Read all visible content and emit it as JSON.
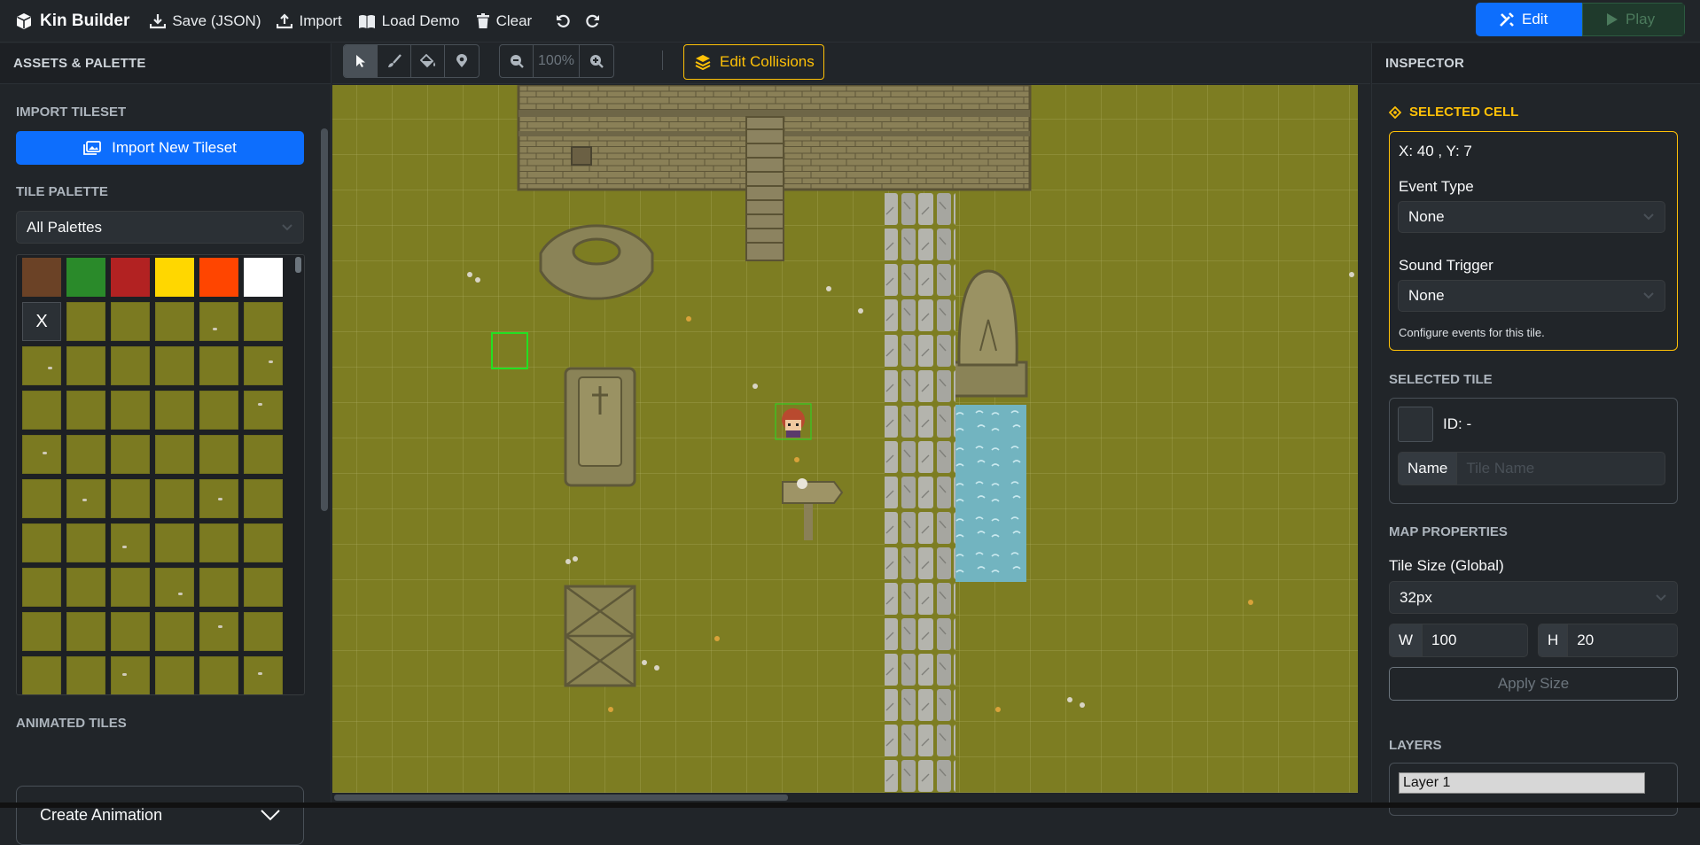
{
  "app": {
    "title": "Kin Builder"
  },
  "toolbar": {
    "save": "Save (JSON)",
    "import": "Import",
    "load_demo": "Load Demo",
    "clear": "Clear",
    "edit": "Edit",
    "play": "Play"
  },
  "left": {
    "header": "ASSETS & PALETTE",
    "import_section": "IMPORT TILESET",
    "import_button": "Import New Tileset",
    "palette_section": "TILE PALETTE",
    "palette_select": "All Palettes",
    "swatches": [
      "#6b4226",
      "#2a8a2a",
      "#b22222",
      "#ffd700",
      "#ff4500",
      "#ffffff"
    ],
    "erase_label": "X",
    "animated_section": "ANIMATED TILES",
    "create_animation": "Create Animation"
  },
  "canvas_tools": {
    "zoom": "100%",
    "edit_collisions": "Edit Collisions"
  },
  "inspector": {
    "header": "INSPECTOR",
    "selected_cell": {
      "title": "SELECTED CELL",
      "coords": "X: 40 , Y: 7",
      "event_type_label": "Event Type",
      "event_type_value": "None",
      "sound_label": "Sound Trigger",
      "sound_value": "None",
      "help": "Configure events for this tile."
    },
    "selected_tile": {
      "title": "SELECTED TILE",
      "id": "ID: -",
      "name_label": "Name",
      "name_placeholder": "Tile Name"
    },
    "map_properties": {
      "title": "MAP PROPERTIES",
      "tile_size_label": "Tile Size (Global)",
      "tile_size_value": "32px",
      "w_label": "W",
      "w_value": "100",
      "h_label": "H",
      "h_value": "20",
      "apply": "Apply Size"
    },
    "layers": {
      "title": "LAYERS",
      "items": [
        "Layer 1"
      ]
    }
  },
  "colors": {
    "accent": "#0d6efd",
    "warning": "#ffc107",
    "grass": "#7d7d22",
    "water": "#72b4c0"
  }
}
